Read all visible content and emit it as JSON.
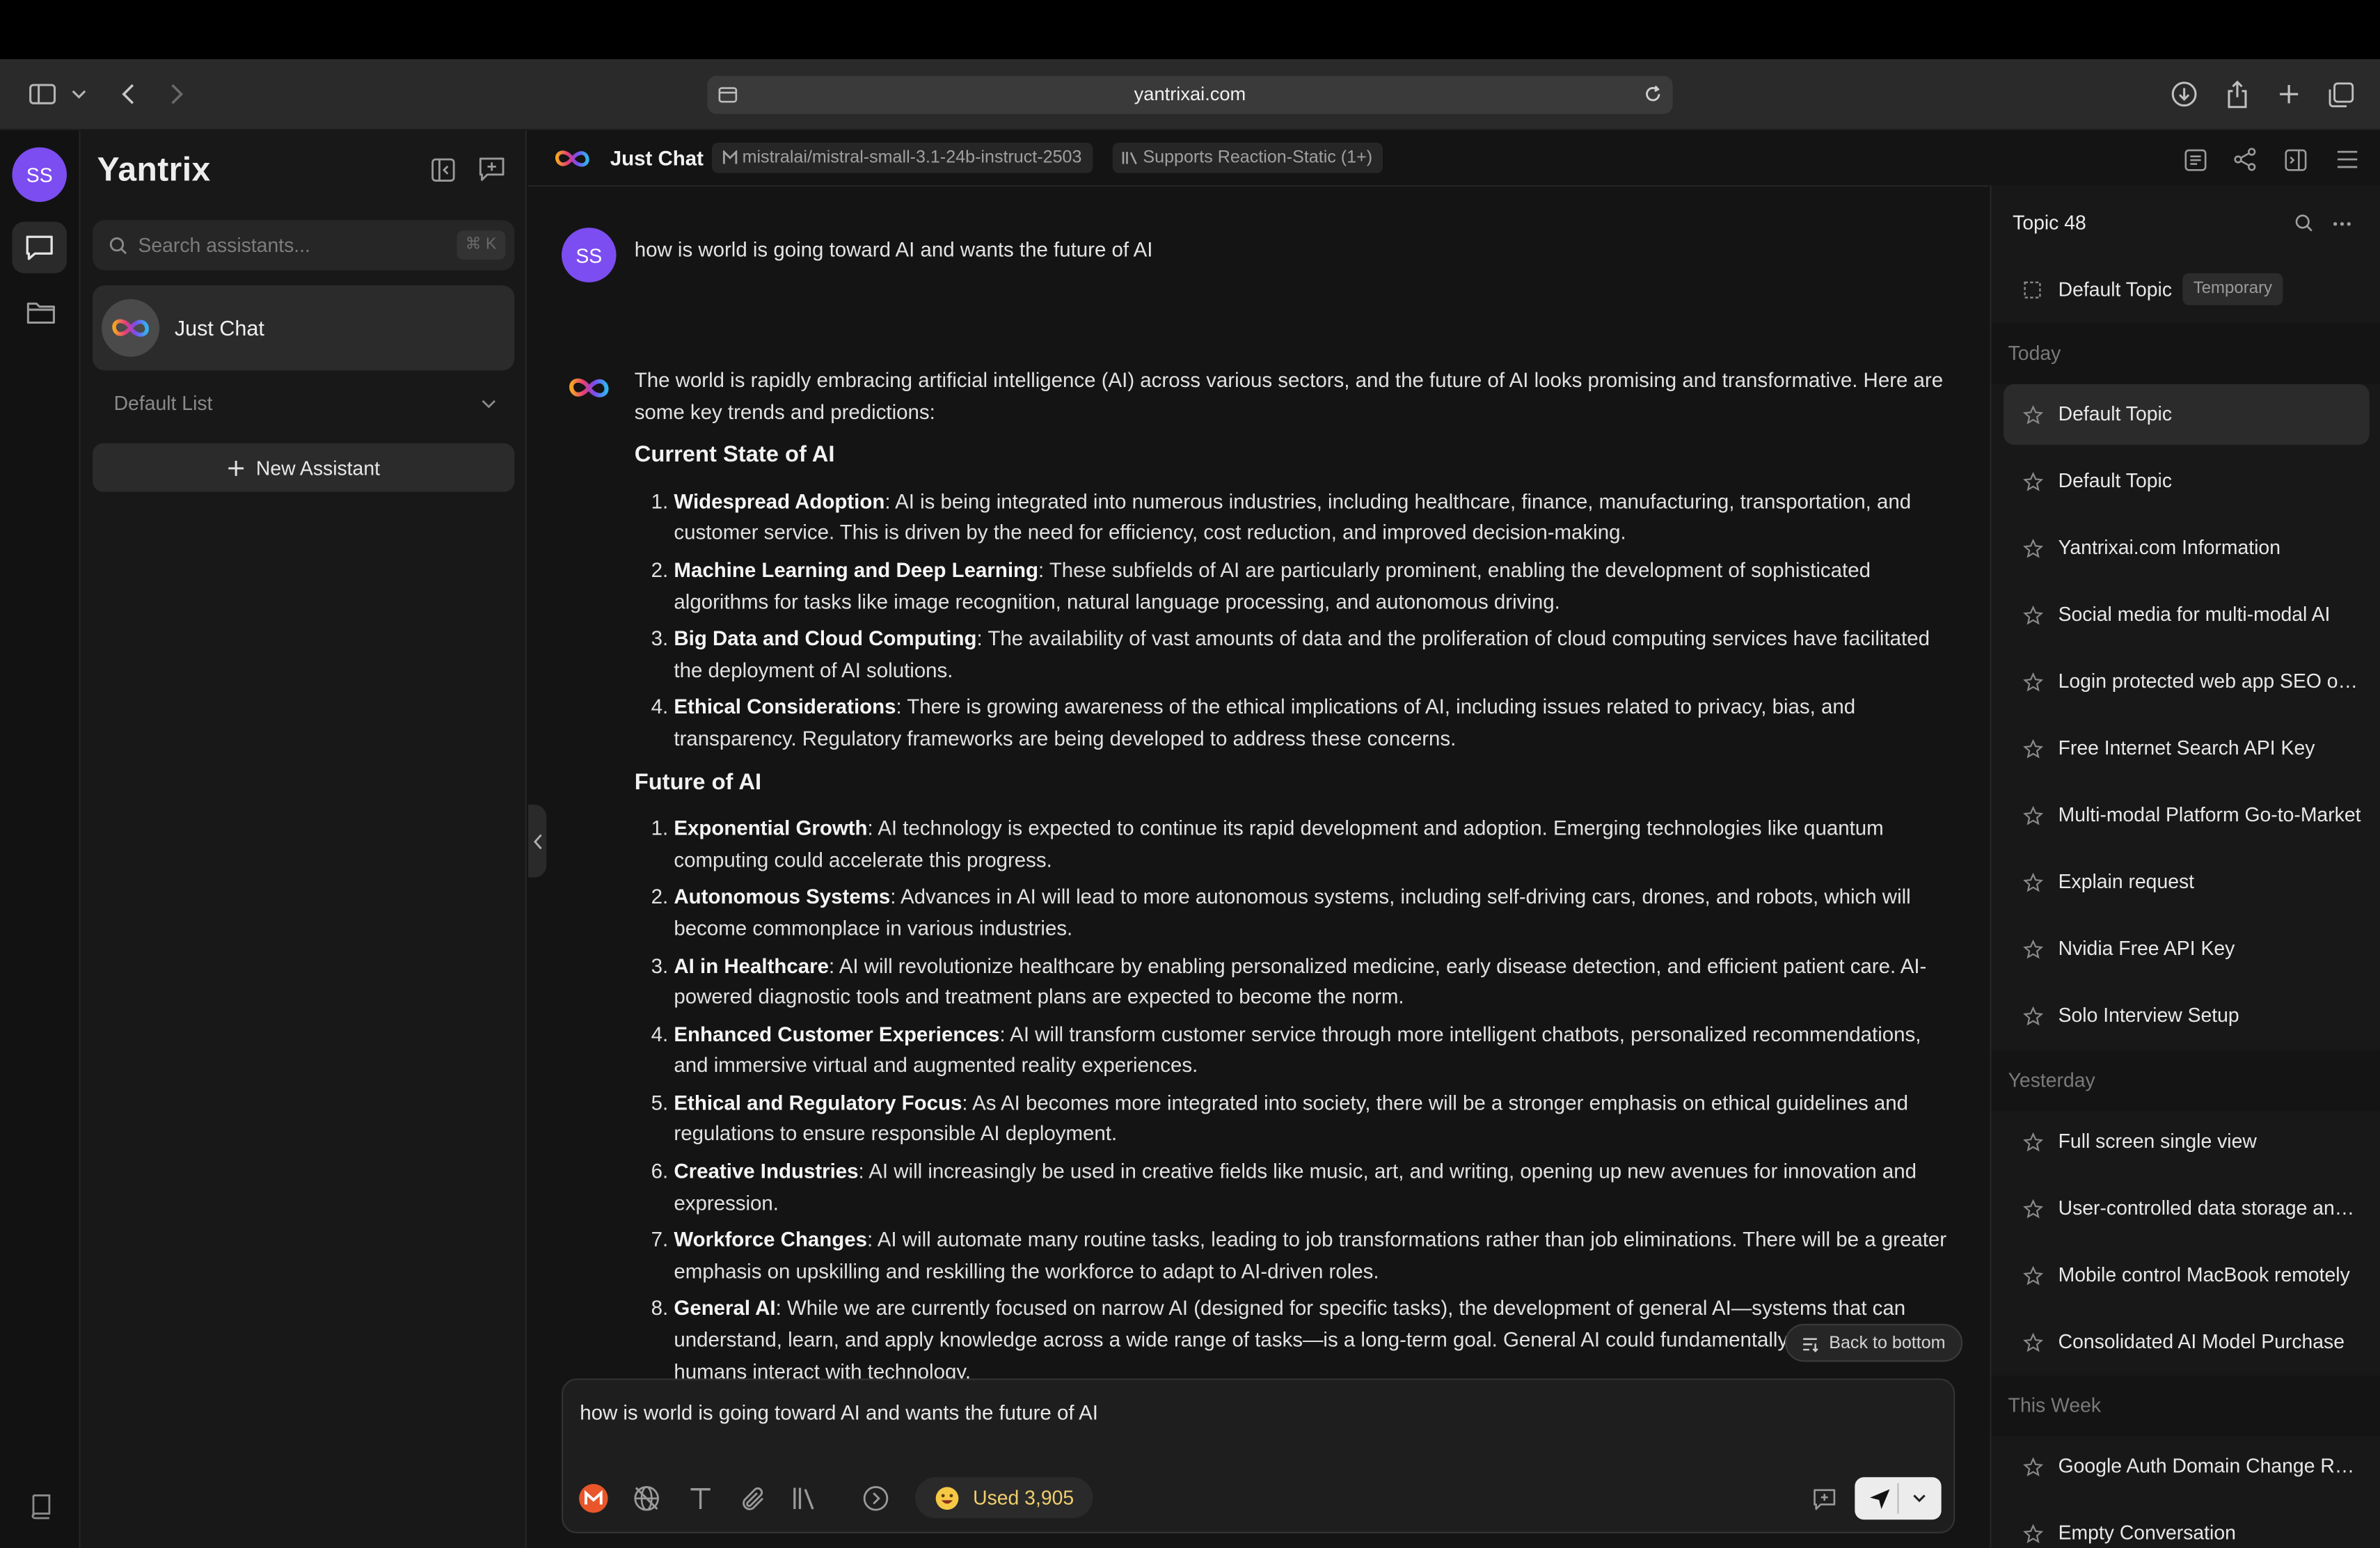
{
  "browser": {
    "url": "yantrixai.com"
  },
  "rail": {
    "avatar_initials": "SS"
  },
  "sidebar": {
    "brand": "Yantrix",
    "search_placeholder": "Search assistants...",
    "search_shortcut": "⌘ K",
    "assistant_label": "Just Chat",
    "list_label": "Default List",
    "new_assistant_label": "New Assistant"
  },
  "chat": {
    "title": "Just Chat",
    "model_chip": "mistralai/mistral-small-3.1-24b-instruct-2503",
    "knowledge_chip": "Supports Reaction-Static (1+)",
    "user_initials": "SS",
    "user_message": "how is world is going toward AI and wants the future of AI",
    "answer": {
      "intro": "The world is rapidly embracing artificial intelligence (AI) across various sectors, and the future of AI looks promising and transformative. Here are some key trends and predictions:",
      "sections": [
        {
          "heading": "Current State of AI",
          "items": [
            {
              "term": "Widespread Adoption",
              "text": ": AI is being integrated into numerous industries, including healthcare, finance, manufacturing, transportation, and customer service. This is driven by the need for efficiency, cost reduction, and improved decision-making."
            },
            {
              "term": "Machine Learning and Deep Learning",
              "text": ": These subfields of AI are particularly prominent, enabling the development of sophisticated algorithms for tasks like image recognition, natural language processing, and autonomous driving."
            },
            {
              "term": "Big Data and Cloud Computing",
              "text": ": The availability of vast amounts of data and the proliferation of cloud computing services have facilitated the deployment of AI solutions."
            },
            {
              "term": "Ethical Considerations",
              "text": ": There is growing awareness of the ethical implications of AI, including issues related to privacy, bias, and transparency. Regulatory frameworks are being developed to address these concerns."
            }
          ]
        },
        {
          "heading": "Future of AI",
          "items": [
            {
              "term": "Exponential Growth",
              "text": ": AI technology is expected to continue its rapid development and adoption. Emerging technologies like quantum computing could accelerate this progress."
            },
            {
              "term": "Autonomous Systems",
              "text": ": Advances in AI will lead to more autonomous systems, including self-driving cars, drones, and robots, which will become commonplace in various industries."
            },
            {
              "term": "AI in Healthcare",
              "text": ": AI will revolutionize healthcare by enabling personalized medicine, early disease detection, and efficient patient care. AI-powered diagnostic tools and treatment plans are expected to become the norm."
            },
            {
              "term": "Enhanced Customer Experiences",
              "text": ": AI will transform customer service through more intelligent chatbots, personalized recommendations, and immersive virtual and augmented reality experiences."
            },
            {
              "term": "Ethical and Regulatory Focus",
              "text": ": As AI becomes more integrated into society, there will be a stronger emphasis on ethical guidelines and regulations to ensure responsible AI deployment."
            },
            {
              "term": "Creative Industries",
              "text": ": AI will increasingly be used in creative fields like music, art, and writing, opening up new avenues for innovation and expression."
            },
            {
              "term": "Workforce Changes",
              "text": ": AI will automate many routine tasks, leading to job transformations rather than job eliminations. There will be a greater emphasis on upskilling and reskilling the workforce to adapt to AI-driven roles."
            },
            {
              "term": "General AI",
              "text": ": While we are currently focused on narrow AI (designed for specific tasks), the development of general AI—systems that can understand, learn, and apply knowledge across a wide range of tasks—is a long-term goal. General AI could fundamentally change how humans interact with technology."
            }
          ]
        }
      ]
    },
    "back_to_bottom": "Back to bottom",
    "composer_text": "how is world is going toward AI and wants the future of AI",
    "usage_label": "Used 3,905"
  },
  "topics": {
    "title": "Topic 48",
    "pinned": {
      "label": "Default Topic",
      "badge": "Temporary"
    },
    "groups": [
      {
        "label": "Today",
        "items": [
          "Default Topic",
          "Default Topic",
          "Yantrixai.com Information",
          "Social media for multi-modal AI",
          "Login protected web app SEO optimization",
          "Free Internet Search API Key",
          "Multi-modal Platform Go-to-Market",
          "Explain request",
          "Nvidia Free API Key",
          "Solo Interview Setup"
        ]
      },
      {
        "label": "Yesterday",
        "items": [
          "Full screen single view",
          "User-controlled data storage and privacy",
          "Mobile control MacBook remotely",
          "Consolidated AI Model Purchase"
        ]
      },
      {
        "label": "This Week",
        "items": [
          "Google Auth Domain Change Request",
          "Empty Conversation"
        ]
      }
    ]
  },
  "colors": {
    "accent": "#7c4df0",
    "usage": "#f0cf6c",
    "background": "#141414"
  }
}
